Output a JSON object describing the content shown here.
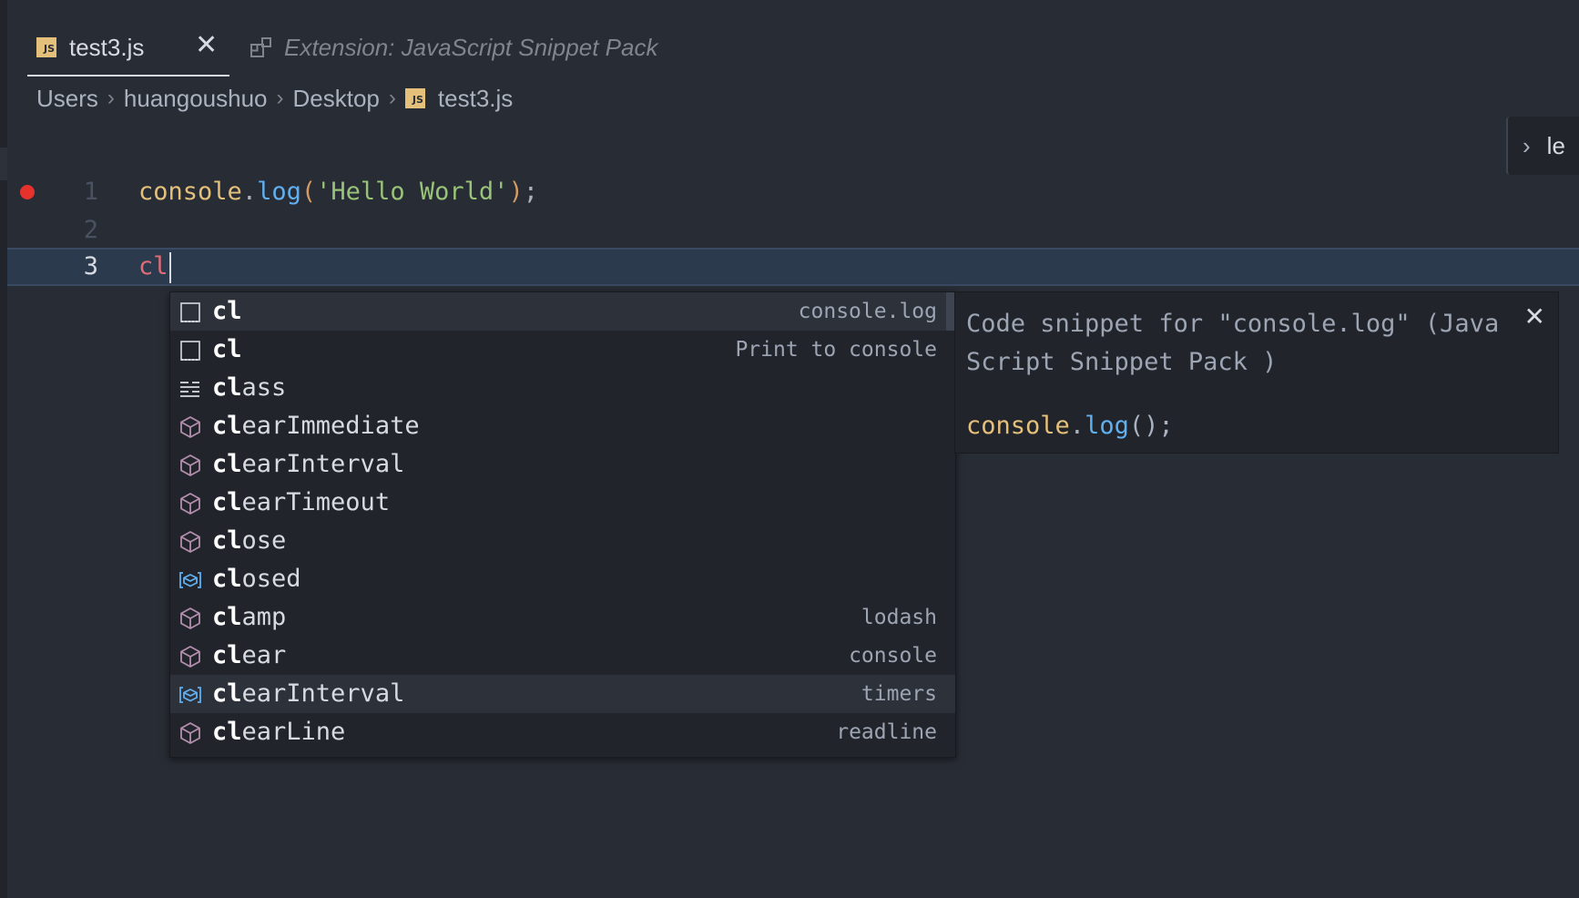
{
  "tabs": [
    {
      "label": "test3.js",
      "icon": "js-file-icon",
      "active": true
    },
    {
      "label": "Extension: JavaScript Snippet Pack",
      "icon": "extension-icon",
      "active": false
    }
  ],
  "breadcrumb": [
    "Users",
    "huangoushuo",
    "Desktop",
    "test3.js"
  ],
  "side_widget": {
    "text": "le"
  },
  "editor": {
    "lines": [
      {
        "number": "1",
        "breakpoint": true
      },
      {
        "number": "2"
      },
      {
        "number": "3"
      }
    ],
    "line1": {
      "obj": "console",
      "dot": ".",
      "fn": "log",
      "open": "(",
      "str": "'Hello World'",
      "close": ")",
      "semi": ";"
    },
    "line3": {
      "typed": "cl"
    }
  },
  "suggestions": [
    {
      "match": "cl",
      "rest": "",
      "detail": "console.log",
      "kind": "snippet"
    },
    {
      "match": "cl",
      "rest": "",
      "detail": "Print to console",
      "kind": "snippet"
    },
    {
      "match": "cl",
      "rest": "ass",
      "detail": "",
      "kind": "keyword"
    },
    {
      "match": "cl",
      "rest": "earImmediate",
      "detail": "",
      "kind": "method"
    },
    {
      "match": "cl",
      "rest": "earInterval",
      "detail": "",
      "kind": "method"
    },
    {
      "match": "cl",
      "rest": "earTimeout",
      "detail": "",
      "kind": "method"
    },
    {
      "match": "cl",
      "rest": "ose",
      "detail": "",
      "kind": "method"
    },
    {
      "match": "cl",
      "rest": "osed",
      "detail": "",
      "kind": "variable"
    },
    {
      "match": "cl",
      "rest": "amp",
      "detail": "lodash",
      "kind": "method"
    },
    {
      "match": "cl",
      "rest": "ear",
      "detail": "console",
      "kind": "method"
    },
    {
      "match": "cl",
      "rest": "earInterval",
      "detail": "timers",
      "kind": "variable"
    },
    {
      "match": "cl",
      "rest": "earLine",
      "detail": "readline",
      "kind": "method"
    }
  ],
  "docs": {
    "description": "Code snippet for \"console.log\" (JavaScript Snippet Pack )",
    "code_obj": "console",
    "code_dot": ".",
    "code_fn": "log",
    "code_rest": "();"
  },
  "colors": {
    "background": "#282c34",
    "widget_bg": "#21252b",
    "method_icon": "#b48ead",
    "variable_icon": "#61afef",
    "breakpoint": "#e5322d"
  }
}
